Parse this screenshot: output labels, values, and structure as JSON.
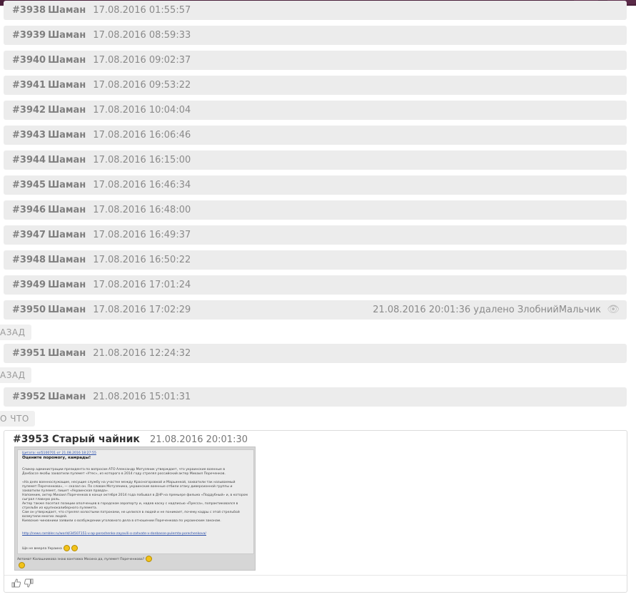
{
  "rows": [
    {
      "num": "#3938",
      "author": "Шаман",
      "date": "17.08.2016 01:55:57"
    },
    {
      "num": "#3939",
      "author": "Шаман",
      "date": "17.08.2016 08:59:33"
    },
    {
      "num": "#3940",
      "author": "Шаман",
      "date": "17.08.2016 09:02:37"
    },
    {
      "num": "#3941",
      "author": "Шаман",
      "date": "17.08.2016 09:53:22"
    },
    {
      "num": "#3942",
      "author": "Шаман",
      "date": "17.08.2016 10:04:04"
    },
    {
      "num": "#3943",
      "author": "Шаман",
      "date": "17.08.2016 16:06:46"
    },
    {
      "num": "#3944",
      "author": "Шаман",
      "date": "17.08.2016 16:15:00"
    },
    {
      "num": "#3945",
      "author": "Шаман",
      "date": "17.08.2016 16:46:34"
    },
    {
      "num": "#3946",
      "author": "Шаман",
      "date": "17.08.2016 16:48:00"
    },
    {
      "num": "#3947",
      "author": "Шаман",
      "date": "17.08.2016 16:49:37"
    },
    {
      "num": "#3948",
      "author": "Шаман",
      "date": "17.08.2016 16:50:22"
    },
    {
      "num": "#3949",
      "author": "Шаман",
      "date": "17.08.2016 17:01:24"
    },
    {
      "num": "#3950",
      "author": "Шаман",
      "date": "17.08.2016 17:02:29",
      "deleted": "21.08.2016 20:01:36 удалено ЗлобнийМальчик"
    },
    {
      "num": "#3951",
      "author": "Шаман",
      "date": "21.08.2016 12:24:32"
    },
    {
      "num": "#3952",
      "author": "Шаман",
      "date": "21.08.2016 15:01:31"
    }
  ],
  "tags": [
    "АЗАД",
    "АЗАД",
    "О ЧТО"
  ],
  "open_post": {
    "num": "#3953",
    "author": "Старый чайник",
    "date": "21.08.2016 20:01:30",
    "quote_header": "Цитата: ssl5100701 от 21.08.2016 18:27:55",
    "quote_title": "Оцените поромогу, камрады!",
    "quote_lines": [
      "Спикер администрации президента по вопросам АТО Александр Мотузяник утверждает, что украинские военные в",
      "Донбассе якобы захватили пулемет «Утес», из которого в 2014 году стрелял российский актер Михаил Пореченков.",
      "«На днях военнослужащие, несущие службу на участке между Красногоровкой и Марьинкой, захватили так называемый",
      "пулемет Пореченкова», — сказал он. По словам Мотузяника, украинские военные отбили атаку диверсионной группы и",
      "захватили пулемет, пишет «Украинская правда».",
      "Напомним, актер Михаил Пореченков в конце октября 2014 года побывал в ДНР на премьере фильма «Поддубный» и, в котором",
      "сыграл главную роль.",
      "Актер также посетил позиции ополченцев в городском аэропорту и, надев каску с надписью «Пресса», попрактиковался в",
      "стрельбе из крупнокалиберного пулемета.",
      "Сам он утверждает, что стрелял холостыми патронами, не целился в людей и не понимает, почему кадры с этой стрельбой",
      "возмутили многих людей.",
      "Киевские чиновники заявили о возбуждении уголовного дела в отношении Пореченкова по украинским законам."
    ],
    "quote_link": "http://news.rambler.ru/world/34507151-v-ap-poroshenko-zayavili-o-zahvate-v-donbasse-pulemta-porechenkova/",
    "quote_footer": "Ще не вмерла Украина",
    "reply_text": "Автомат Калашникова знаю вантовка Мосина да, пулемет Пореченкова?",
    "icons": {
      "like": "thumbs-up-icon",
      "dislike": "thumbs-down-icon",
      "view": "eye-icon"
    }
  }
}
